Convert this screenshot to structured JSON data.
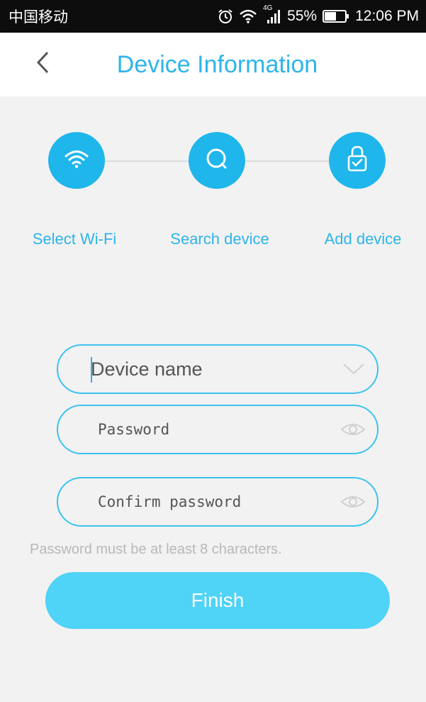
{
  "status_bar": {
    "carrier": "中国移动",
    "network": "4G",
    "battery": "55%",
    "time": "12:06 PM"
  },
  "header": {
    "title": "Device Information",
    "back_icon": "chevron-left-icon"
  },
  "steps": [
    {
      "label": "Select Wi-Fi",
      "icon": "wifi-icon"
    },
    {
      "label": "Search device",
      "icon": "search-icon"
    },
    {
      "label": "Add device",
      "icon": "lock-check-icon"
    }
  ],
  "form": {
    "device_name": {
      "value": "",
      "placeholder": "Device name",
      "icon": "chevron-down-icon"
    },
    "password": {
      "value": "",
      "placeholder": "Password",
      "icon": "eye-icon"
    },
    "confirm_password": {
      "value": "",
      "placeholder": "Confirm password",
      "icon": "eye-icon"
    },
    "hint": "Password must be at least 8 characters."
  },
  "finish_label": "Finish",
  "colors": {
    "accent": "#2eb4ea",
    "step_fill": "#1fb6ec",
    "button": "#4fd3f7",
    "field_border": "#3cc3ee",
    "background": "#f2f2f2"
  }
}
